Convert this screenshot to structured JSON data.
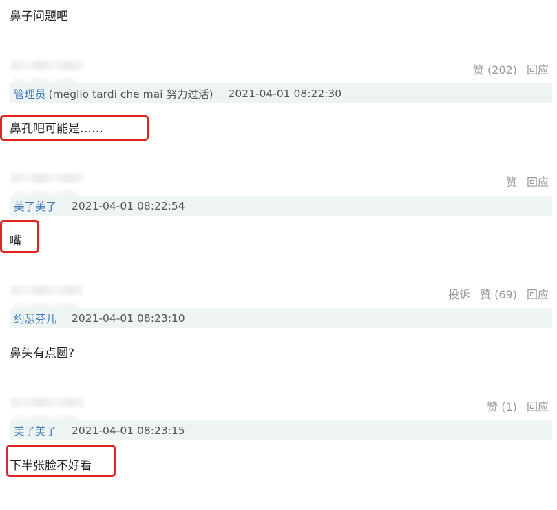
{
  "top_text": "鼻子问题吧",
  "comments": [
    {
      "actions": {
        "report": "",
        "like": "赞 (202)",
        "reply": "回应"
      },
      "user": "管理员",
      "user_note": "(meglio tardi che mai 努力过活)",
      "time": "2021-04-01 08:22:30",
      "text": "鼻孔吧可能是……"
    },
    {
      "actions": {
        "report": "",
        "like": "赞",
        "reply": "回应"
      },
      "user": "美了美了",
      "user_note": "",
      "time": "2021-04-01 08:22:54",
      "text": "嘴"
    },
    {
      "actions": {
        "report": "投诉",
        "like": "赞 (69)",
        "reply": "回应"
      },
      "user": "约瑟芬儿",
      "user_note": "",
      "time": "2021-04-01 08:23:10",
      "text": "鼻头有点圆?"
    },
    {
      "actions": {
        "report": "",
        "like": "赞 (1)",
        "reply": "回应"
      },
      "user": "美了美了",
      "user_note": "",
      "time": "2021-04-01 08:23:15",
      "text": "下半张脸不好看"
    }
  ],
  "colors": {
    "highlight": "#e02424",
    "username": "#3f7ab8",
    "meta_bar": "#eef4f3"
  }
}
